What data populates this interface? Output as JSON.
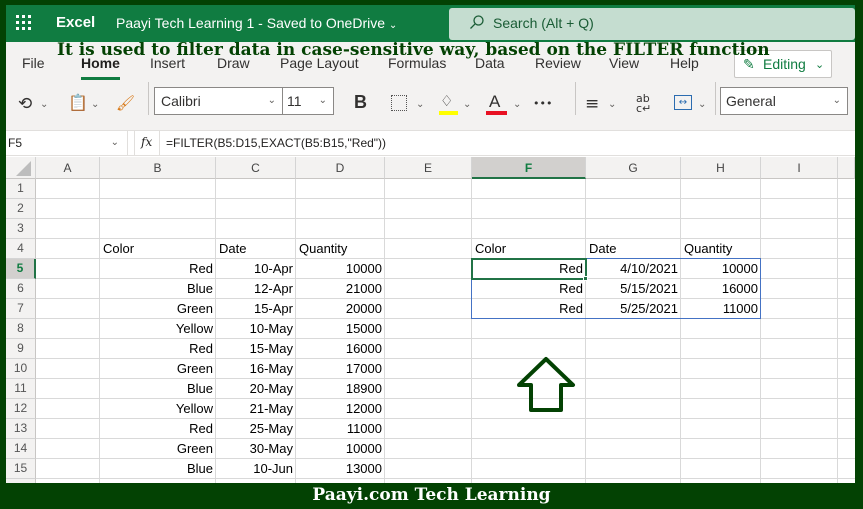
{
  "titlebar": {
    "app_name": "Excel",
    "document": "Paayi Tech Learning 1  -  Saved to OneDrive",
    "search_placeholder": "Search (Alt + Q)"
  },
  "ribbon": {
    "tabs": [
      "File",
      "Home",
      "Insert",
      "Draw",
      "Page Layout",
      "Formulas",
      "Data",
      "Review",
      "View",
      "Help"
    ],
    "active_tab": "Home",
    "mode_button": "Editing",
    "font_name": "Calibri",
    "font_size": "11",
    "number_format": "General",
    "bold_label": "B",
    "font_color_label": "A",
    "more_label": "•••",
    "colors": {
      "highlight": "#ffff00",
      "font_color": "#e81123",
      "accent": "#107c41"
    }
  },
  "formula_bar": {
    "name_box": "F5",
    "fx_label": "fx",
    "formula": "=FILTER(B5:D15,EXACT(B5:B15,\"Red\"))"
  },
  "sheet": {
    "columns": [
      "A",
      "B",
      "C",
      "D",
      "E",
      "F",
      "G",
      "H",
      "I"
    ],
    "selected_column": "F",
    "rows": [
      "1",
      "2",
      "3",
      "4",
      "5",
      "6",
      "7",
      "8",
      "9",
      "10",
      "11",
      "12",
      "13",
      "14",
      "15"
    ],
    "selected_row": "5",
    "title": "It is used to filter data in case-sensitive way, based on the FILTER function",
    "source_headers": [
      "Color",
      "Date",
      "Quantity"
    ],
    "source_rows": [
      [
        "Red",
        "10-Apr",
        "10000"
      ],
      [
        "Blue",
        "12-Apr",
        "21000"
      ],
      [
        "Green",
        "15-Apr",
        "20000"
      ],
      [
        "Yellow",
        "10-May",
        "15000"
      ],
      [
        "Red",
        "15-May",
        "16000"
      ],
      [
        "Green",
        "16-May",
        "17000"
      ],
      [
        "Blue",
        "20-May",
        "18900"
      ],
      [
        "Yellow",
        "21-May",
        "12000"
      ],
      [
        "Red",
        "25-May",
        "11000"
      ],
      [
        "Green",
        "30-May",
        "10000"
      ],
      [
        "Blue",
        "10-Jun",
        "13000"
      ]
    ],
    "result_headers": [
      "Color",
      "Date",
      "Quantity"
    ],
    "result_rows": [
      [
        "Red",
        "4/10/2021",
        "10000"
      ],
      [
        "Red",
        "5/15/2021",
        "16000"
      ],
      [
        "Red",
        "5/25/2021",
        "11000"
      ]
    ]
  },
  "footer": {
    "text": "Paayi.com Tech Learning"
  }
}
